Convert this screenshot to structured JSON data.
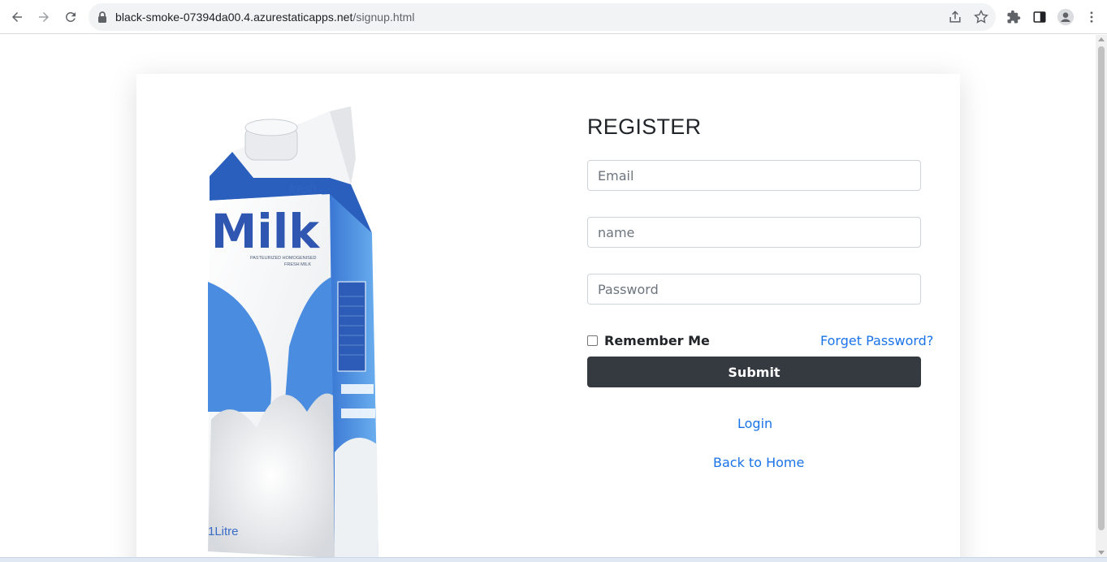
{
  "browser": {
    "url_host": "black-smoke-07394da00.4.azurestaticapps.net",
    "url_path": "/signup.html"
  },
  "form": {
    "title": "REGISTER",
    "email_placeholder": "Email",
    "name_placeholder": "name",
    "password_placeholder": "Password",
    "remember_label": "Remember Me",
    "remember_checked": false,
    "forgot_link": "Forget Password?",
    "submit_label": "Submit",
    "login_link": "Login",
    "back_home_link": "Back to Home"
  },
  "carton": {
    "brand_small": "fresh",
    "brand": "Milk",
    "tagline_1": "PASTEURIZED HOMOGENISED",
    "tagline_2": "FRESH MILK",
    "volume": "1Litre"
  },
  "colors": {
    "accent_link": "#1a73e8",
    "button_dark": "#343a40",
    "carton_blue": "#2f63c4",
    "carton_light_blue": "#5fa1e6"
  }
}
